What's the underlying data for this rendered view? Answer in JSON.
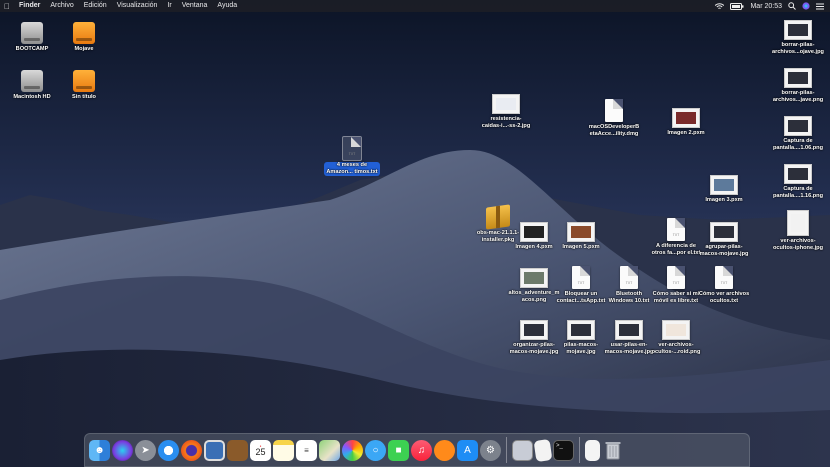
{
  "menubar": {
    "app": "Finder",
    "items": [
      "Archivo",
      "Edición",
      "Visualización",
      "Ir",
      "Ventana",
      "Ayuda"
    ],
    "clock": "Mar 20:53"
  },
  "desktop": {
    "left_icons": [
      {
        "label": "BOOTCAMP",
        "kind": "drive-gray"
      },
      {
        "label": "Mojave",
        "kind": "drive-orange"
      },
      {
        "label": "Macintosh HD",
        "kind": "drive-gray"
      },
      {
        "label": "Sin título",
        "kind": "drive-orange"
      }
    ],
    "selected_file": {
      "line1": "4 meses de",
      "line2": "Amazon... timos.txt"
    },
    "files": [
      {
        "line1": "resistencia-",
        "line2": "caidas-i...-ss-2.jpg"
      },
      {
        "line1": "macOSDeveloperB",
        "line2": "etaAcce...ility.dmg"
      },
      {
        "line1": "Imagen 2.pxm",
        "line2": ""
      },
      {
        "line1": "Imagen 3.pxm",
        "line2": ""
      },
      {
        "line1": "obs-mac-21.1.1-",
        "line2": "installer.pkg"
      },
      {
        "line1": "Imagen 4.pxm",
        "line2": ""
      },
      {
        "line1": "Imagen 5.pxm",
        "line2": ""
      },
      {
        "line1": "A diferencia de",
        "line2": "otros fa...por el.txt"
      },
      {
        "line1": "agrupar-pilas-",
        "line2": "macos-mojave.jpg"
      },
      {
        "line1": "altos_adventure_m",
        "line2": "acos.png"
      },
      {
        "line1": "Bloquear un",
        "line2": "contact...tsApp.txt"
      },
      {
        "line1": "Bluetooth",
        "line2": "Windows 10.txt"
      },
      {
        "line1": "Cómo saber si mi",
        "line2": "móvil es libre.txt"
      },
      {
        "line1": "Cómo ver archivos",
        "line2": "ocultos.txt"
      },
      {
        "line1": "organizar-pilas-",
        "line2": "macos-mojave.jpg"
      },
      {
        "line1": "pilas-macos-",
        "line2": "mojave.jpg"
      },
      {
        "line1": "usar-pilas-en-",
        "line2": "macos-mojave.jpg"
      },
      {
        "line1": "ver-archivos-",
        "line2": "ocultos-...roid.png"
      }
    ],
    "right_column": [
      {
        "line1": "borrar-pilas-",
        "line2": "archivos...ojave.jpg"
      },
      {
        "line1": "borrar-pilas-",
        "line2": "archivos...jave.png"
      },
      {
        "line1": "Captura de",
        "line2": "pantalla....1.06.png"
      },
      {
        "line1": "Captura de",
        "line2": "pantalla....1.16.png"
      },
      {
        "line1": "ver-archivos-",
        "line2": "ocultos-iphone.jpg"
      }
    ]
  },
  "dock": {
    "apps": [
      "finder-icon",
      "siri-icon",
      "launchpad-icon",
      "safari-icon",
      "firefox-icon",
      "preview-icon",
      "notebook-icon",
      "calendar-icon",
      "notes-icon",
      "reminders-icon",
      "maps-icon",
      "photos-icon",
      "messages-icon",
      "facetime-icon",
      "music-icon",
      "books-icon",
      "app-store-icon",
      "system-preferences-icon"
    ],
    "calendar_day": "25",
    "extras": [
      "screenshots-stack-icon",
      "document-stack-icon",
      "terminal-icon",
      "text-document-icon",
      "trash-icon"
    ]
  }
}
